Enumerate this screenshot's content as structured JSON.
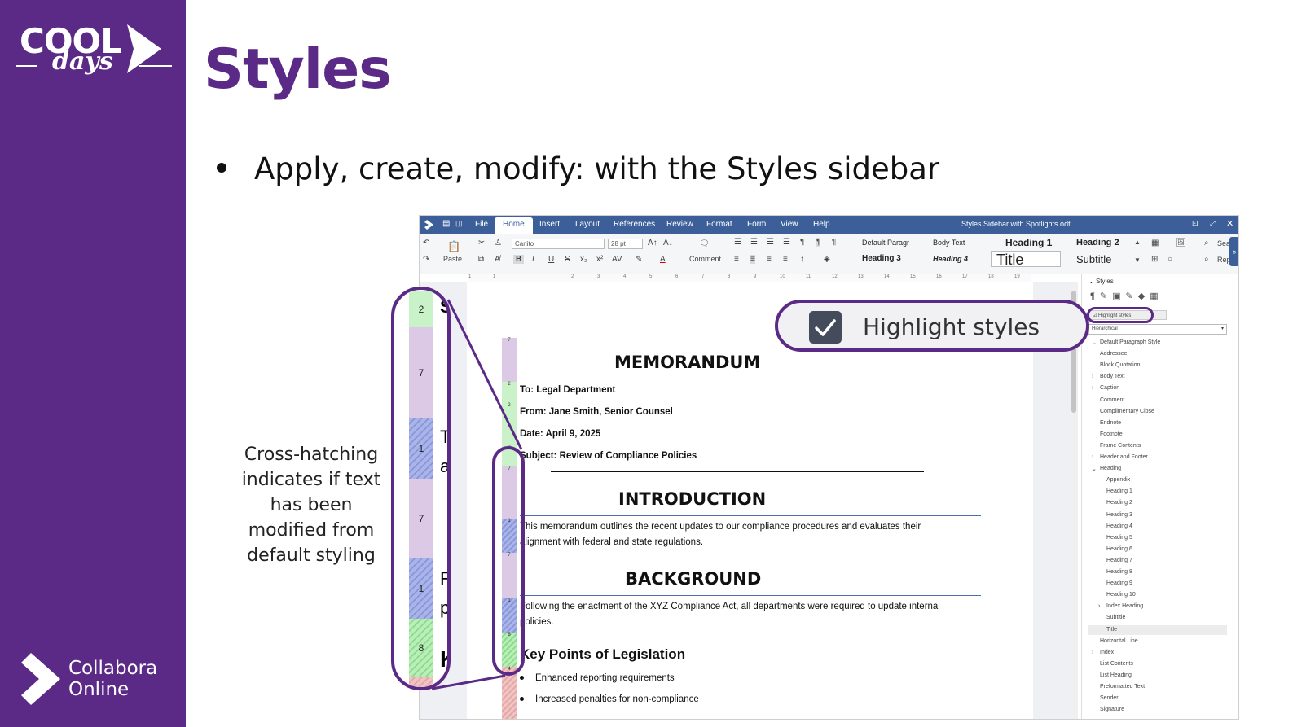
{
  "slide": {
    "title": "Styles",
    "bullet": "Apply, create, modify: with the Styles sidebar",
    "caption": "Cross-hatching indicates if text has been modified from default styling"
  },
  "branding": {
    "cool": "COOL",
    "days": "days",
    "collabora_line1": "Collabora",
    "collabora_line2": "Online"
  },
  "colors": {
    "brand_purple": "#5b2a86",
    "menubar_blue": "#3c5f9a"
  },
  "app": {
    "doc_title": "Styles Sidebar with Spotlights.odt",
    "menu": [
      "File",
      "Home",
      "Insert",
      "Layout",
      "References",
      "Review",
      "Format",
      "Form",
      "View",
      "Help"
    ],
    "active_menu": "Home",
    "font_name": "Carlito",
    "font_size": "28 pt",
    "paste_label": "Paste",
    "comment_label": "Comment",
    "styles_gallery": {
      "default_para": "Default Paragr",
      "body_text": "Body Text",
      "heading1": "Heading 1",
      "heading2": "Heading 2",
      "heading3": "Heading 3",
      "heading4": "Heading 4",
      "title": "Title",
      "subtitle": "Subtitle"
    },
    "search_label": "Sea",
    "replace_label": "Rep",
    "ruler_ticks": [
      "1",
      "1",
      "2",
      "3",
      "4",
      "5",
      "6",
      "7",
      "8",
      "9",
      "10",
      "11",
      "12",
      "13",
      "14",
      "15",
      "16",
      "17",
      "18",
      "19"
    ]
  },
  "document": {
    "heading_memo": "MEMORANDUM",
    "to": "To: Legal Department",
    "from": "From: Jane Smith, Senior Counsel",
    "date": "Date: April 9, 2025",
    "subject_label": "Subject:",
    "subject_text": " Review of Compliance Policies",
    "heading_intro": "INTRODUCTION",
    "intro_line1": "This memorandum outlines the recent updates to our compliance procedures and evaluates their",
    "intro_line2": "alignment with federal and state regulations.",
    "heading_background": "BACKGROUND",
    "bg_line1": "Following the enactment of the XYZ Compliance Act, all departments were required to update internal",
    "bg_line2": "policies.",
    "heading_key": "Key Points of Legislation",
    "bullets": [
      "Enhanced reporting requirements",
      "Increased penalties for non-compliance"
    ]
  },
  "spotlight_small": [
    "7",
    "2",
    "2",
    "2",
    "2",
    "7",
    "1",
    "7",
    "1",
    "8",
    "4"
  ],
  "spotlight_zoom": [
    "2",
    "7",
    "1",
    "7",
    "1",
    "8"
  ],
  "zoom_letters": [
    "S",
    "T",
    "a",
    "F",
    "p",
    "K"
  ],
  "sidebar": {
    "header": "Styles",
    "highlight_checkbox": "Highlight styles",
    "filter": "Hierarchical",
    "items": [
      "Default Paragraph Style",
      "Addressee",
      "Block Quotation",
      "Body Text",
      "Caption",
      "Comment",
      "Complimentary Close",
      "Endnote",
      "Footnote",
      "Frame Contents",
      "Header and Footer",
      "Heading",
      "Appendix",
      "Heading 1",
      "Heading 2",
      "Heading 3",
      "Heading 4",
      "Heading 5",
      "Heading 6",
      "Heading 7",
      "Heading 8",
      "Heading 9",
      "Heading 10",
      "Index Heading",
      "Subtitle",
      "Title",
      "Horizontal Line",
      "Index",
      "List Contents",
      "List Heading",
      "Preformatted Text",
      "Sender",
      "Signature"
    ],
    "selected": "Title"
  },
  "callout": {
    "label": "Highlight styles"
  }
}
